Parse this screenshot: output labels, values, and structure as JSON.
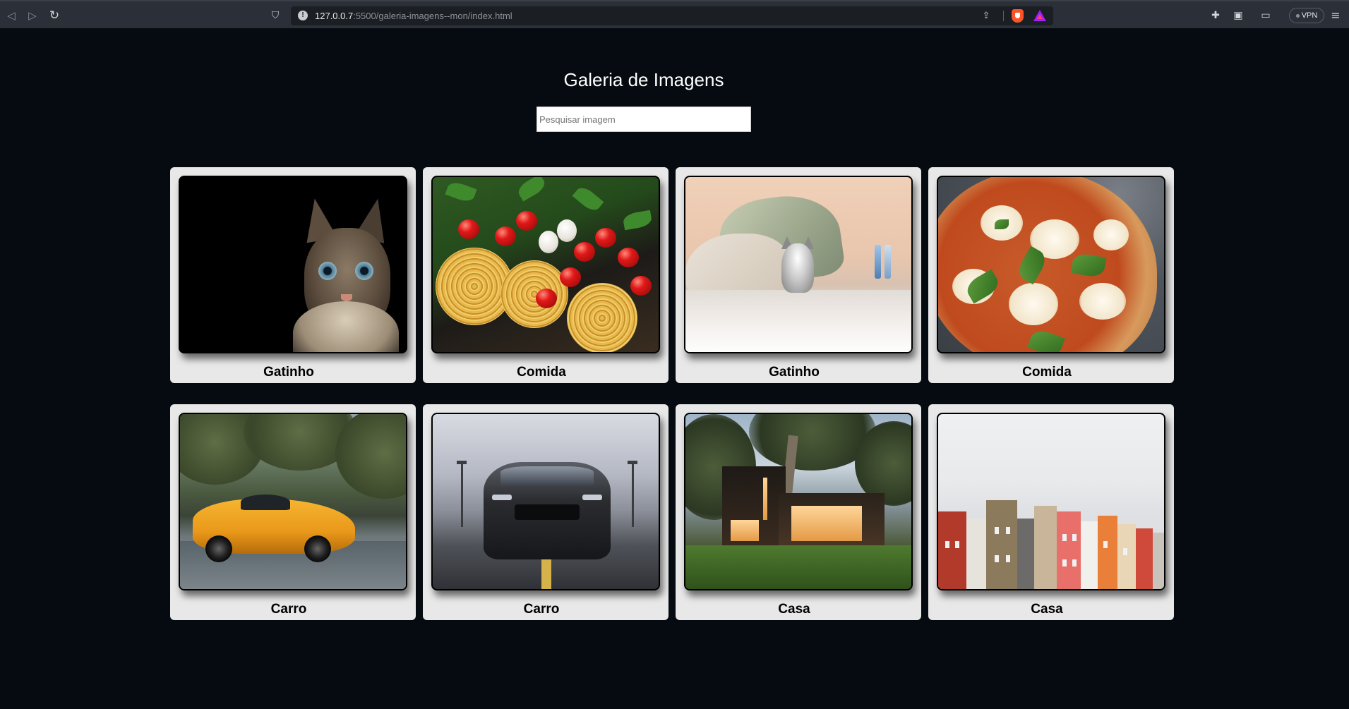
{
  "browser": {
    "url_host": "127.0.0.7",
    "url_rest": ":5500/galeria-imagens--mon/index.html",
    "vpn_label": "VPN",
    "icons": {
      "back": "back-arrow-icon",
      "forward": "forward-arrow-icon",
      "reload": "reload-icon",
      "bookmark": "bookmark-icon",
      "site_info": "site-info-icon",
      "share": "share-icon",
      "brave_shields": "brave-shields-icon",
      "brave_rewards": "brave-rewards-icon",
      "extensions": "puzzle-icon",
      "sidebar": "sidebar-icon",
      "wallet": "wallet-icon",
      "menu": "menu-icon"
    }
  },
  "page": {
    "title": "Galeria de Imagens",
    "search_placeholder": "Pesquisar imagem",
    "search_value": "",
    "background_color": "#050b10",
    "card_color": "#e8e8e8"
  },
  "gallery": [
    {
      "label": "Gatinho",
      "photo": "cat-black-background"
    },
    {
      "label": "Comida",
      "photo": "pasta-and-tomatoes"
    },
    {
      "label": "Gatinho",
      "photo": "kitten-on-bed"
    },
    {
      "label": "Comida",
      "photo": "margherita-pizza"
    },
    {
      "label": "Carro",
      "photo": "yellow-sports-car"
    },
    {
      "label": "Carro",
      "photo": "black-mustang"
    },
    {
      "label": "Casa",
      "photo": "modern-house"
    },
    {
      "label": "Casa",
      "photo": "colorful-townhouses"
    }
  ]
}
